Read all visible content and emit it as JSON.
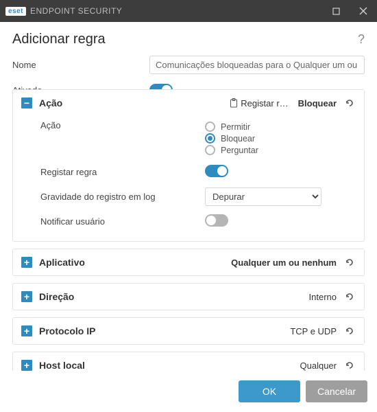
{
  "titlebar": {
    "brand_badge": "eset",
    "brand_product": "ENDPOINT SECURITY"
  },
  "header": {
    "title": "Adicionar regra"
  },
  "form": {
    "name_label": "Nome",
    "name_value": "Comunicações bloqueadas para o Qualquer um ou nenhum",
    "enabled_label": "Ativado",
    "enabled": true
  },
  "panels": {
    "action": {
      "title": "Ação",
      "summary_log_prefix": "Registar r…",
      "summary_value": "Bloquear",
      "fields": {
        "action_label": "Ação",
        "options": {
          "allow": "Permitir",
          "block": "Bloquear",
          "ask": "Perguntar"
        },
        "selected": "block",
        "log_rule_label": "Registar regra",
        "log_rule_on": true,
        "log_severity_label": "Gravidade do registro em log",
        "log_severity_value": "Depurar",
        "notify_user_label": "Notificar usuário",
        "notify_user_on": false
      }
    },
    "application": {
      "title": "Aplicativo",
      "summary": "Qualquer um ou nenhum"
    },
    "direction": {
      "title": "Direção",
      "summary": "Interno"
    },
    "ip_protocol": {
      "title": "Protocolo IP",
      "summary": "TCP e UDP"
    },
    "local_host": {
      "title": "Host local",
      "summary": "Qualquer"
    }
  },
  "footer": {
    "ok": "OK",
    "cancel": "Cancelar"
  }
}
